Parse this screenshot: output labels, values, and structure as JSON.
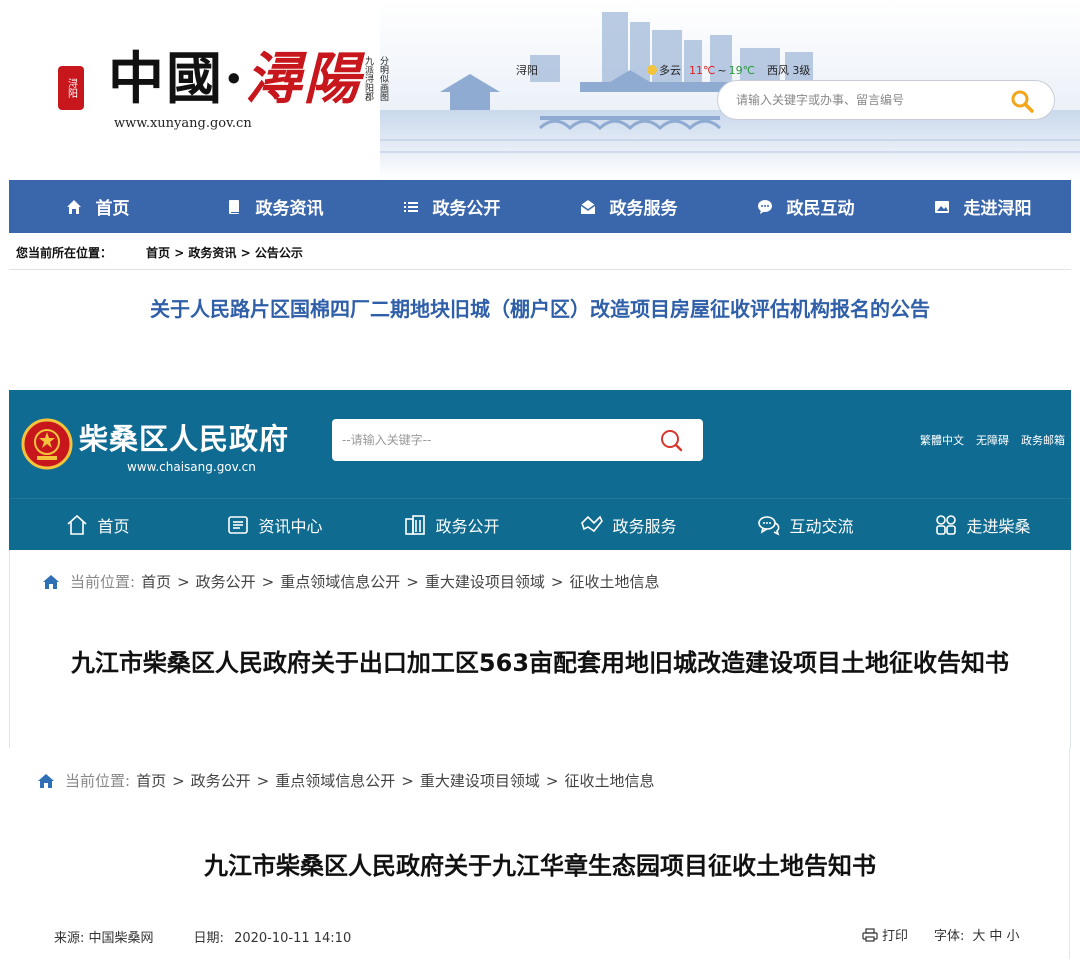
{
  "xunyang": {
    "seal_text": "浔阳",
    "logo_main": "中國·",
    "logo_red": "潯陽",
    "logo_url": "www.xunyang.gov.cn",
    "motto": [
      "九派浔阳郡",
      "分明似画图"
    ],
    "city": "浔阳",
    "weather": {
      "condition": "多云",
      "temp_low": "11℃",
      "sep": "~",
      "temp_high": "19℃",
      "wind": "西风 3级"
    },
    "search_placeholder": "请输入关键字或办事、留言编号",
    "nav": [
      {
        "label": "首页",
        "icon": "home-icon"
      },
      {
        "label": "政务资讯",
        "icon": "document-icon"
      },
      {
        "label": "政务公开",
        "icon": "list-icon"
      },
      {
        "label": "政务服务",
        "icon": "mail-icon"
      },
      {
        "label": "政民互动",
        "icon": "chat-icon"
      },
      {
        "label": "走进浔阳",
        "icon": "image-icon"
      }
    ],
    "breadcrumb_label": "您当前所在位置：",
    "breadcrumb_path": "首页 > 政务资讯 > 公告公示",
    "title": "关于人民路片区国棉四厂二期地块旧城（棚户区）改造项目房屋征收评估机构报名的公告",
    "colors": {
      "nav_bg": "#3a66ac",
      "title": "#2f5fa8",
      "accent_red": "#c8161d"
    }
  },
  "chaisang": {
    "logo": "柴桑区人民政府",
    "url": "www.chaisang.gov.cn",
    "search_placeholder": "--请输入关键字--",
    "links": [
      "繁體中文",
      "无障碍",
      "政务邮箱"
    ],
    "nav": [
      {
        "label": "首页",
        "icon": "home-outline-icon"
      },
      {
        "label": "资讯中心",
        "icon": "news-icon"
      },
      {
        "label": "政务公开",
        "icon": "building-icon"
      },
      {
        "label": "政务服务",
        "icon": "handshake-icon"
      },
      {
        "label": "互动交流",
        "icon": "chat-bubbles-icon"
      },
      {
        "label": "走进柴桑",
        "icon": "grid-icon"
      }
    ],
    "breadcrumb_label": "当前位置:",
    "breadcrumb": [
      "首页",
      "政务公开",
      "重点领域信息公开",
      "重大建设项目领域",
      "征收土地信息"
    ],
    "title": "九江市柴桑区人民政府关于出口加工区563亩配套用地旧城改造建设项目土地征收告知书",
    "colors": {
      "header_bg": "#106b93",
      "search_icon": "#d6392f"
    }
  },
  "notice": {
    "breadcrumb_label": "当前位置:",
    "breadcrumb": [
      "首页",
      "政务公开",
      "重点领域信息公开",
      "重大建设项目领域",
      "征收土地信息"
    ],
    "title": "九江市柴桑区人民政府关于九江华章生态园项目征收土地告知书",
    "source_label": "来源:",
    "source": "中国柴桑网",
    "date_label": "日期:",
    "date": "2020-10-11 14:10",
    "print_label": "打印",
    "font_label": "字体:",
    "font_sizes": [
      "大",
      "中",
      "小"
    ]
  }
}
